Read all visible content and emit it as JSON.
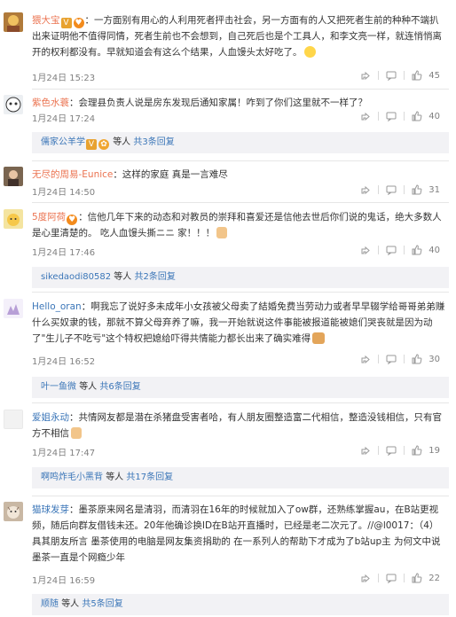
{
  "comments": [
    {
      "user": "猥大宝",
      "text": "：一方面别有用心的人利用死者抨击社会，另一方面有的人又把死者生前的种种不端扒出来证明他不值得同情，死者生前也不会想到，自己死后也是个工具人，和李文亮一样，就连悄悄离开的权利都没有。早就知道会有这么个结果，人血馒头太好吃了。",
      "time": "1月24日 15:23",
      "likes": "45"
    },
    {
      "user": "紫色水蓑",
      "text": "：会理县负责人说是房东发现后通知家属！咋到了你们这里就不一样了？",
      "time": "1月24日 17:24",
      "likes": "40",
      "reply": {
        "user": "儒家公羊学",
        "total_prefix": "等人",
        "total_link": "共3条回复"
      }
    },
    {
      "user": "无尽的周易-Eunice",
      "text": "：这样的家庭 真是一言难尽",
      "time": "1月24日 14:50",
      "likes": "31"
    },
    {
      "user": "5度阿荷",
      "text": "：信他几年下来的动态和对教员的崇拜和喜爱还是信他去世后你们说的鬼话，绝大多数人是心里清楚的。 吃人血馒头撕ニニ 家！！！",
      "time": "1月24日 17:46",
      "likes": "40",
      "reply": {
        "user": "sikedaodi80582",
        "total_prefix": "等人",
        "total_link": "共2条回复"
      }
    },
    {
      "user": "Hello_oran",
      "text": "：啊我忘了说好多未成年小女孩被父母卖了結婚免费当劳动力或者早早辍学给哥哥弟弟赚什么买奴隶的钱，那就不算父母弃养了嘛，我一开始就说这件事能被报道能被媳们哭丧就是因为动了\"生儿子不吃亏\"这个特权把媳给吓得共情能力都长出来了确实难得",
      "time": "1月24日 16:52",
      "likes": "30",
      "reply": {
        "user": "叶一鱼微",
        "total_prefix": "等人",
        "total_link": "共6条回复"
      }
    },
    {
      "user": "爱姐永动",
      "text": "：共情网友都是潜在杀猪盘受害者哈，有人朋友圈整造富二代相信，整造没钱相信，只有官方不相信",
      "time": "1月24日 17:47",
      "likes": "19",
      "reply": {
        "user": "啊鸣炸毛小黑背",
        "total_prefix": "等人",
        "total_link": "共17条回复"
      }
    },
    {
      "user": "猫球发芽",
      "text": "：墨茶原来网名是清羽，而清羽在16年的时候就加入了ow群，还熟练掌握au，在B站更视频，随后向群友借钱未还。20年他确诊换ID在B站开直播时，已经是老二次元了。//@l0017：（4）具其朋友所言 墨茶使用的电脑是网友集资捐助的 在一系列人的帮助下才成为了b站up主 为何文中说墨茶一直是个网瘾少年",
      "time": "1月24日 16:59",
      "likes": "22",
      "reply": {
        "user": "顺随",
        "total_prefix": "等人",
        "total_link": "共5条回复"
      }
    }
  ],
  "icons": {
    "share": "share-icon",
    "comment": "comment-icon",
    "like": "thumbs-up-icon"
  },
  "colors": {
    "username": "#eb7350",
    "link": "#3b76b8",
    "reply_bg": "#f2f2f5",
    "meta": "#808080"
  }
}
